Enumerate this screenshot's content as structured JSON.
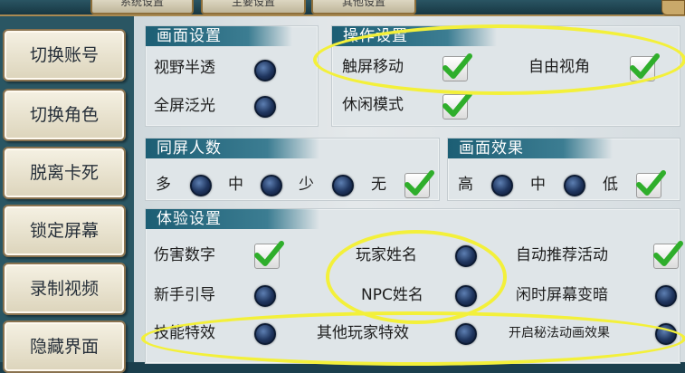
{
  "header": {
    "tabs": [
      {
        "label": "系统设置"
      },
      {
        "label": "主要设置"
      },
      {
        "label": "其他设置"
      }
    ]
  },
  "sidebar": {
    "items": [
      {
        "label": "切换账号"
      },
      {
        "label": "切换角色"
      },
      {
        "label": "脱离卡死"
      },
      {
        "label": "锁定屏幕"
      },
      {
        "label": "录制视频"
      },
      {
        "label": "隐藏界面"
      }
    ]
  },
  "sections": {
    "display": {
      "title": "画面设置",
      "options": [
        {
          "label": "视野半透",
          "checked": false
        },
        {
          "label": "全屏泛光",
          "checked": false
        }
      ]
    },
    "controls": {
      "title": "操作设置",
      "options": [
        {
          "label": "触屏移动",
          "checked": true
        },
        {
          "label": "自由视角",
          "checked": true
        },
        {
          "label": "休闲模式",
          "checked": true
        }
      ]
    },
    "same_screen": {
      "title": "同屏人数",
      "options": [
        {
          "label": "多",
          "checked": false
        },
        {
          "label": "中",
          "checked": false
        },
        {
          "label": "少",
          "checked": false
        },
        {
          "label": "无",
          "checked": true
        }
      ]
    },
    "effects": {
      "title": "画面效果",
      "options": [
        {
          "label": "高",
          "checked": false
        },
        {
          "label": "中",
          "checked": false
        },
        {
          "label": "低",
          "checked": true
        }
      ]
    },
    "experience": {
      "title": "体验设置",
      "options": [
        {
          "label": "伤害数字",
          "checked": true
        },
        {
          "label": "玩家姓名",
          "checked": false
        },
        {
          "label": "自动推荐活动",
          "checked": true
        },
        {
          "label": "新手引导",
          "checked": false
        },
        {
          "label": "NPC姓名",
          "checked": false
        },
        {
          "label": "闲时屏幕变暗",
          "checked": false
        },
        {
          "label": "技能特效",
          "checked": false
        },
        {
          "label": "其他玩家特效",
          "checked": false
        },
        {
          "label": "开启秘法动画效果",
          "checked": false
        }
      ]
    }
  },
  "colors": {
    "annotation": "#f3f03a",
    "section_header": "#1c5e74",
    "check_green": "#2fae2b"
  }
}
